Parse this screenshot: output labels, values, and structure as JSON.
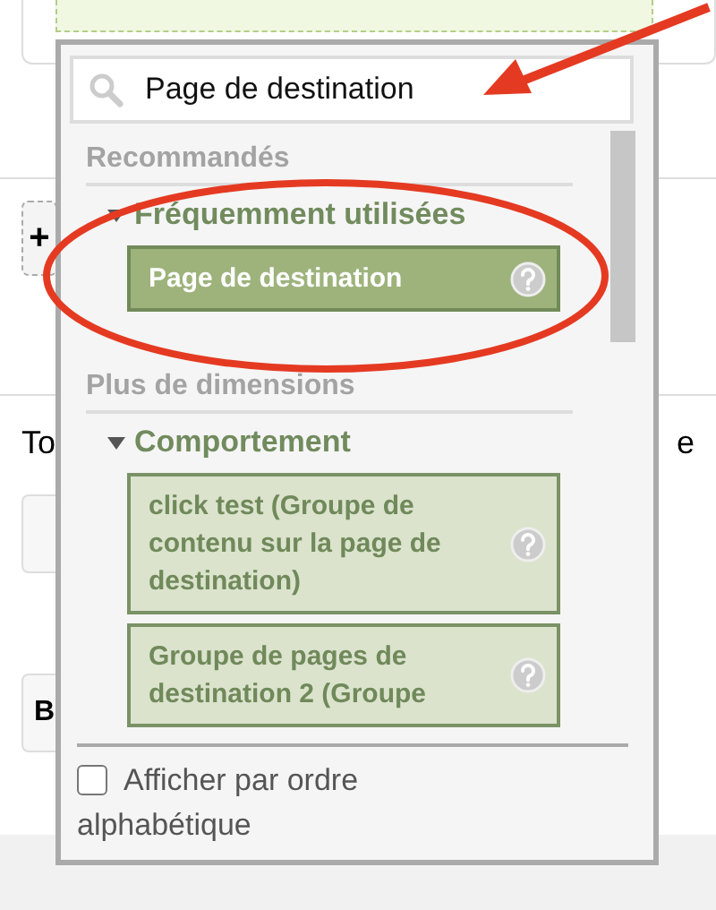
{
  "background": {
    "add_button": "+",
    "text_left": "To",
    "text_right": "e",
    "side_button": "B"
  },
  "popup": {
    "search": {
      "value": "Page de destination"
    },
    "sections": [
      {
        "title": "Recommandés",
        "groups": [
          {
            "title": "Fréquemment utilisées",
            "expanded": true,
            "items": [
              {
                "label": "Page de destination",
                "selected": true
              }
            ]
          }
        ]
      },
      {
        "title": "Plus de dimensions",
        "groups": [
          {
            "title": "Comportement",
            "expanded": true,
            "items": [
              {
                "label": "click test (Groupe de contenu sur la page de destination)",
                "selected": false
              },
              {
                "label": "Groupe de pages de destination 2 (Groupe",
                "selected": false
              }
            ]
          }
        ]
      }
    ],
    "alphabetical": {
      "label": "Afficher par ordre alphabétique",
      "checked": false
    }
  }
}
